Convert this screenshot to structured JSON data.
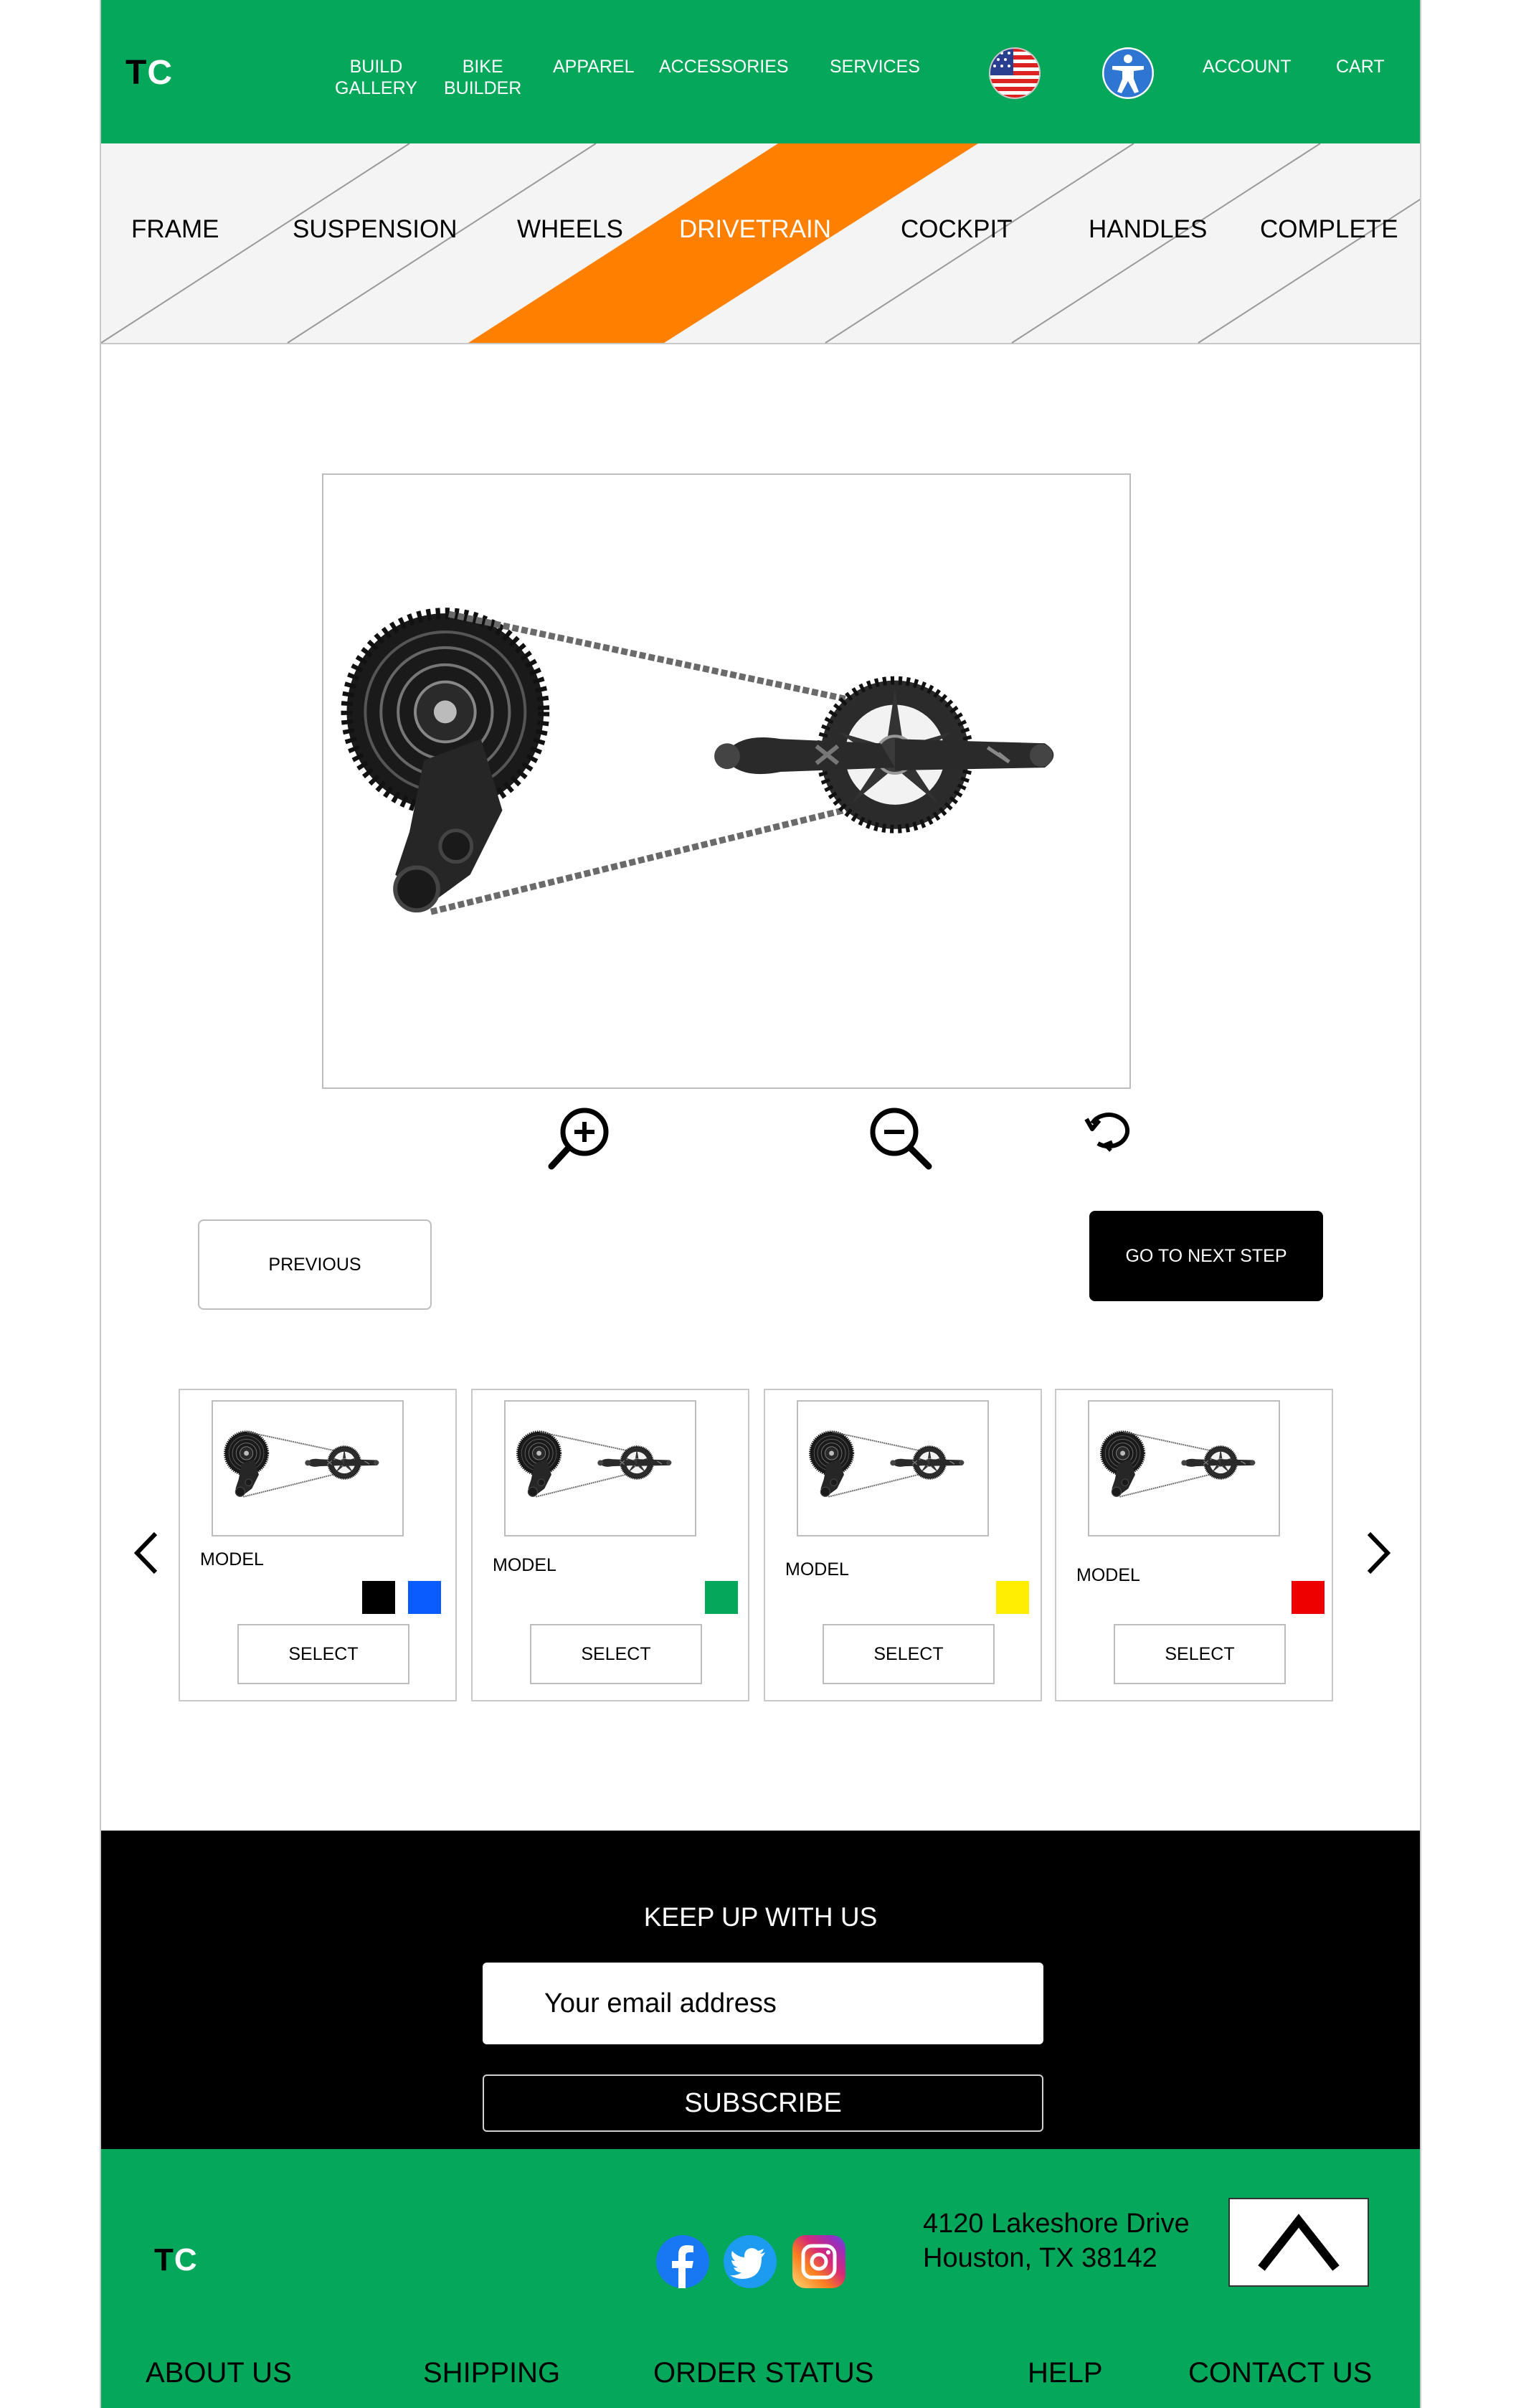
{
  "header": {
    "logo": {
      "t": "T",
      "c": "C"
    },
    "nav": {
      "build_gallery": [
        "BUILD",
        "GALLERY"
      ],
      "bike_builder": [
        "BIKE",
        "BUILDER"
      ],
      "apparel": "APPAREL",
      "accessories": "ACCESSORIES",
      "services": "SERVICES",
      "account": "ACCOUNT",
      "cart": "CART"
    },
    "icons": {
      "flag": "us-flag-icon",
      "accessibility": "accessibility-icon"
    }
  },
  "steps": {
    "items": [
      "FRAME",
      "SUSPENSION",
      "WHEELS",
      "DRIVETRAIN",
      "COCKPIT",
      "HANDLES",
      "COMPLETE"
    ],
    "active": "DRIVETRAIN",
    "active_color": "#ff8000"
  },
  "viewer": {
    "image": "drivetrain-product-image",
    "tools": [
      "zoom-in-icon",
      "zoom-out-icon",
      "rotate-icon"
    ]
  },
  "buttons": {
    "previous": "PREVIOUS",
    "next": "GO TO NEXT STEP"
  },
  "carousel": {
    "cards": [
      {
        "model": "MODEL",
        "swatches": [
          "#000000",
          "#0a5cff"
        ],
        "select": "SELECT"
      },
      {
        "model": "MODEL",
        "swatches": [
          "#000000",
          "#05a75a"
        ],
        "select": "SELECT"
      },
      {
        "model": "MODEL",
        "swatches": [
          "#000000",
          "#ffee00"
        ],
        "select": "SELECT"
      },
      {
        "model": "MODEL",
        "swatches": [
          "#000000",
          "#ee0000"
        ],
        "select": "SELECT"
      }
    ]
  },
  "newsletter": {
    "title": "KEEP UP WITH US",
    "email_placeholder": "Your email address",
    "subscribe": "SUBSCRIBE"
  },
  "footer": {
    "logo": {
      "t": "T",
      "c": "C"
    },
    "social": [
      "facebook-icon",
      "twitter-icon",
      "instagram-icon"
    ],
    "address": [
      "4120 Lakeshore Drive",
      "Houston, TX 38142"
    ],
    "links": [
      "ABOUT US",
      "SHIPPING",
      "ORDER STATUS",
      "HELP",
      "CONTACT US"
    ]
  },
  "colors": {
    "brand_green": "#05a75a",
    "active_orange": "#ff8000",
    "black": "#000000",
    "white": "#ffffff"
  }
}
